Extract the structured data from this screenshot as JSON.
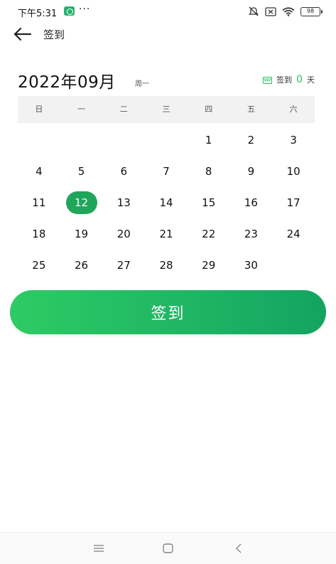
{
  "status_bar": {
    "time": "下午5:31",
    "dots": "···",
    "battery": "98",
    "icons": [
      "app-shield-icon",
      "mute-icon",
      "sim-icon",
      "wifi-icon",
      "battery-icon"
    ]
  },
  "header": {
    "back_icon": "back-arrow-icon",
    "title": "签到"
  },
  "calendar": {
    "month_title": "2022年09月",
    "weekday": "周一",
    "checkin_label": "签到",
    "checkin_count": "0",
    "checkin_unit": "天",
    "week_days": [
      "日",
      "一",
      "二",
      "三",
      "四",
      "五",
      "六"
    ],
    "days": [
      "",
      "",
      "",
      "",
      "1",
      "2",
      "3",
      "4",
      "5",
      "6",
      "7",
      "8",
      "9",
      "10",
      "11",
      "12",
      "13",
      "14",
      "15",
      "16",
      "17",
      "18",
      "19",
      "20",
      "21",
      "22",
      "23",
      "24",
      "25",
      "26",
      "27",
      "28",
      "29",
      "30",
      ""
    ],
    "selected_day": "12",
    "selected_color": "#1fa65a"
  },
  "action": {
    "checkin_button": "签到"
  },
  "colors": {
    "accent": "#2ecb63",
    "accent_dark": "#14a361"
  },
  "nav": {
    "icons": [
      "menu-icon",
      "home-icon",
      "back-icon"
    ]
  }
}
